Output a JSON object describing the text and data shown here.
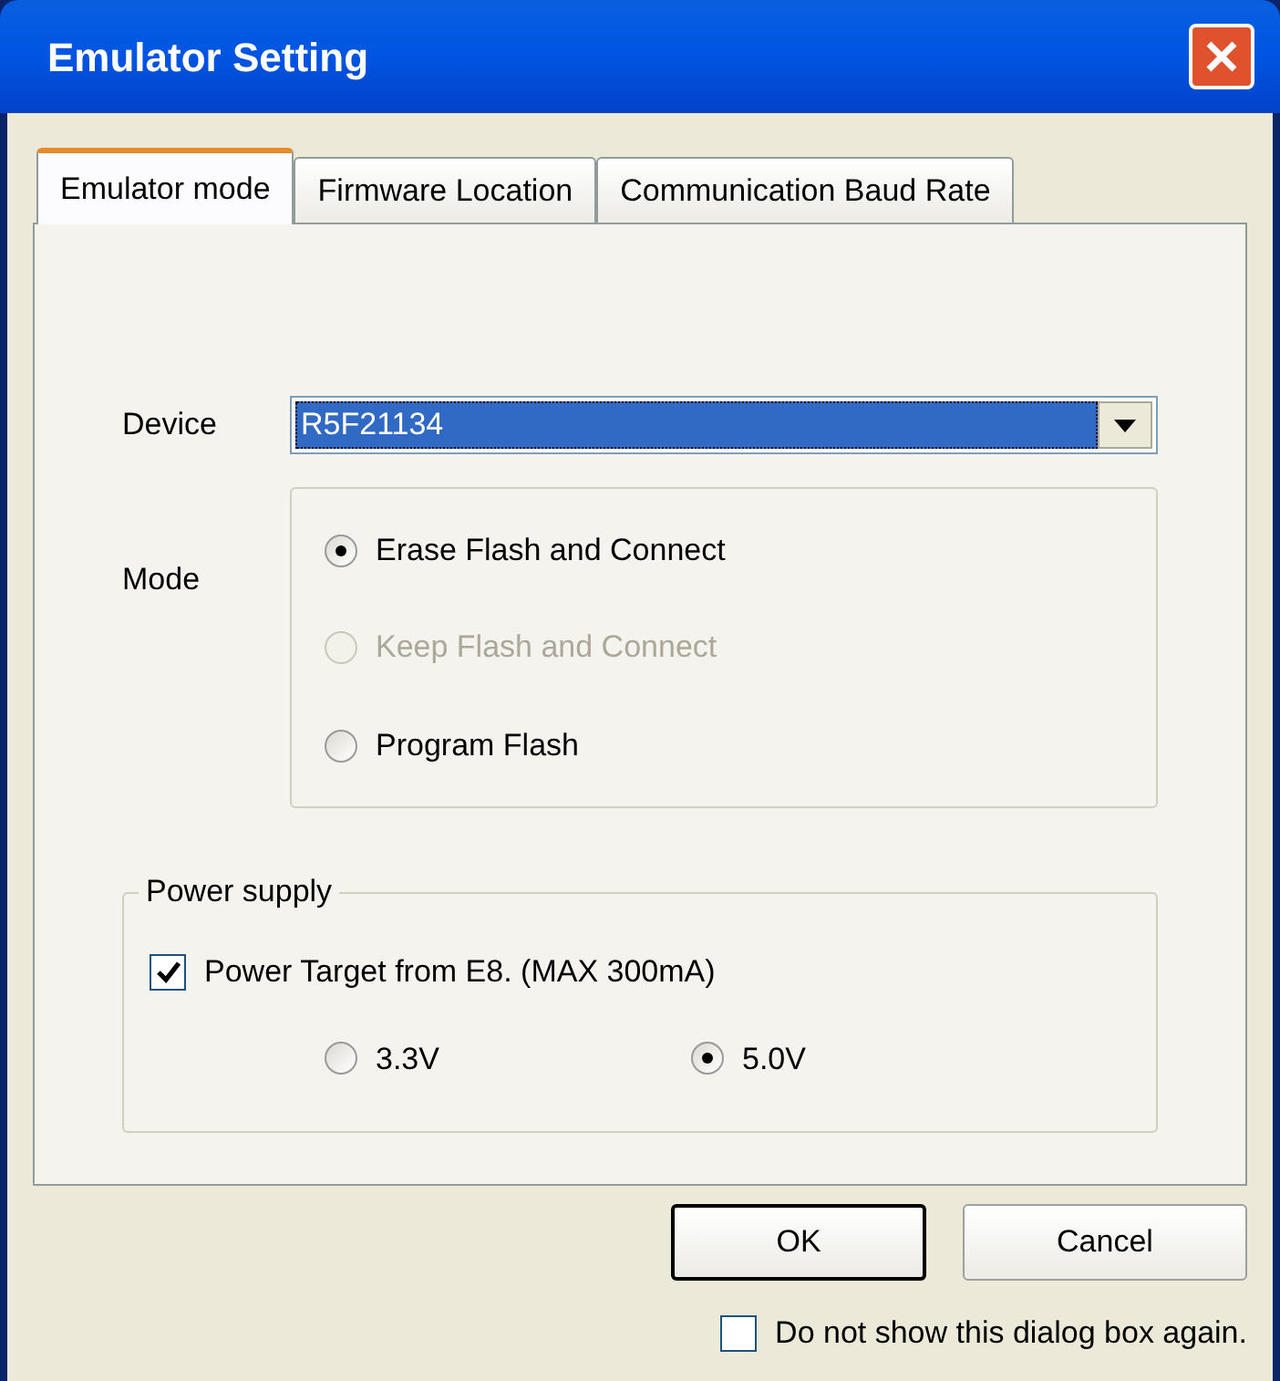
{
  "window": {
    "title": "Emulator Setting"
  },
  "tabs": [
    {
      "label": "Emulator mode",
      "selected": true
    },
    {
      "label": "Firmware Location",
      "selected": false
    },
    {
      "label": "Communication Baud Rate",
      "selected": false
    }
  ],
  "device": {
    "label": "Device",
    "value": "R5F21134"
  },
  "mode": {
    "label": "Mode",
    "options": [
      {
        "label": "Erase Flash and Connect",
        "selected": true,
        "disabled": false
      },
      {
        "label": "Keep Flash and Connect",
        "selected": false,
        "disabled": true
      },
      {
        "label": "Program Flash",
        "selected": false,
        "disabled": false
      }
    ]
  },
  "power_supply": {
    "title": "Power supply",
    "checkbox": {
      "label": "Power Target from E8. (MAX 300mA)",
      "checked": true
    },
    "voltages": [
      {
        "label": "3.3V",
        "selected": false
      },
      {
        "label": "5.0V",
        "selected": true
      }
    ]
  },
  "buttons": [
    {
      "label": "OK",
      "default": true
    },
    {
      "label": "Cancel",
      "default": false
    }
  ],
  "dont_show": {
    "label": "Do not show this dialog box again.",
    "checked": false
  }
}
